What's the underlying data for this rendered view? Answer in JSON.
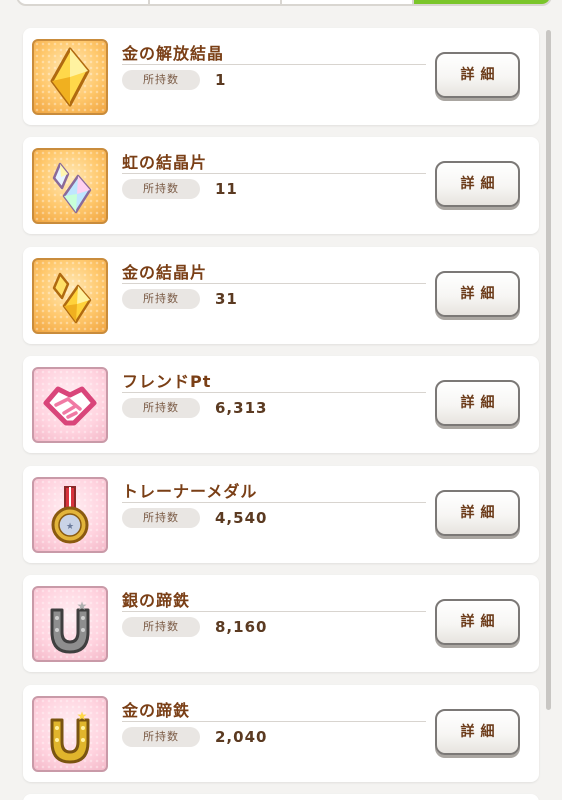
{
  "detail_label": "詳細",
  "own_label": "所持数",
  "items": [
    {
      "name": "金の解放結晶",
      "count": "1",
      "icon": "gold-release-crystal-icon",
      "bg": "orange"
    },
    {
      "name": "虹の結晶片",
      "count": "11",
      "icon": "rainbow-crystal-shard-icon",
      "bg": "orange"
    },
    {
      "name": "金の結晶片",
      "count": "31",
      "icon": "gold-crystal-shard-icon",
      "bg": "orange"
    },
    {
      "name": "フレンドPt",
      "count": "6,313",
      "icon": "friend-points-handshake-icon",
      "bg": "pink"
    },
    {
      "name": "トレーナーメダル",
      "count": "4,540",
      "icon": "trainer-medal-icon",
      "bg": "pink"
    },
    {
      "name": "銀の蹄鉄",
      "count": "8,160",
      "icon": "silver-horseshoe-icon",
      "bg": "pink"
    },
    {
      "name": "金の蹄鉄",
      "count": "2,040",
      "icon": "gold-horseshoe-icon",
      "bg": "pink"
    }
  ],
  "colors": {
    "name_text": "#7a3f16",
    "tab_active": "#7ac52a",
    "card_bg": "#ffffff",
    "page_bg": "#f4f3f1"
  }
}
